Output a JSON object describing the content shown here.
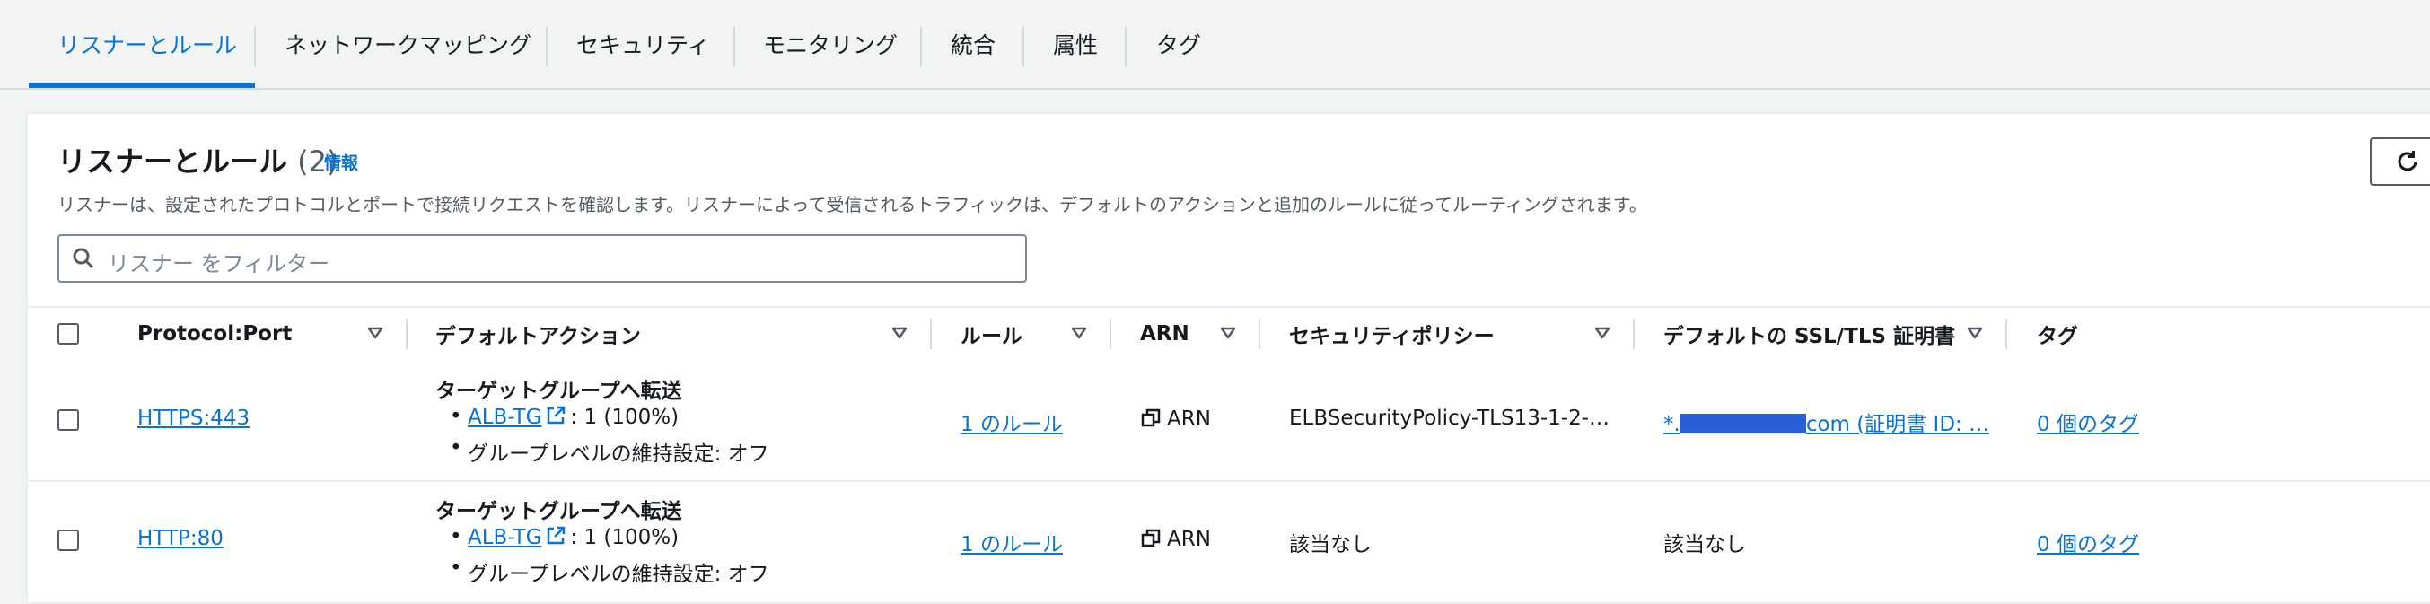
{
  "tabs": [
    {
      "label": "リスナーとルール"
    },
    {
      "label": "ネットワークマッピング"
    },
    {
      "label": "セキュリティ"
    },
    {
      "label": "モニタリング"
    },
    {
      "label": "統合"
    },
    {
      "label": "属性"
    },
    {
      "label": "タグ"
    }
  ],
  "panel": {
    "title": "リスナーとルール",
    "count": "(2)",
    "info": "情報",
    "description": "リスナーは、設定されたプロトコルとポートで接続リクエストを確認します。リスナーによって受信されるトラフィックは、デフォルトのアクションと追加のルールに従ってルーティングされます。",
    "search_placeholder": "リスナー をフィルター"
  },
  "columns": [
    {
      "label": "Protocol:Port"
    },
    {
      "label": "デフォルトアクション"
    },
    {
      "label": "ルール"
    },
    {
      "label": "ARN"
    },
    {
      "label": "セキュリティポリシー"
    },
    {
      "label": "デフォルトの SSL/TLS 証明書"
    },
    {
      "label": "タグ"
    }
  ],
  "rows": [
    {
      "protocol_port": "HTTPS:443",
      "action_title": "ターゲットグループへ転送",
      "target_group": "ALB-TG",
      "target_weight": ": 1 (100%)",
      "stickiness": "グループレベルの維持設定: オフ",
      "rules": "1 のルール",
      "arn": "ARN",
      "security_policy": "ELBSecurityPolicy-TLS13-1-2-…",
      "cert_prefix": "*.",
      "cert_suffix": "com (証明書 ID: …",
      "tags": "0 個のタグ"
    },
    {
      "protocol_port": "HTTP:80",
      "action_title": "ターゲットグループへ転送",
      "target_group": "ALB-TG",
      "target_weight": ": 1 (100%)",
      "stickiness": "グループレベルの維持設定: オフ",
      "rules": "1 のルール",
      "arn": "ARN",
      "security_policy": "該当なし",
      "certificate": "該当なし",
      "tags": "0 個のタグ"
    }
  ],
  "colors": {
    "accent": "#0972d3",
    "text": "#16191f",
    "muted": "#545b64",
    "background": "#f2f3f3",
    "redaction": "#2b5fd9"
  },
  "icons": [
    "refresh-icon",
    "search-icon",
    "sort-caret-icon",
    "external-link-icon",
    "copy-icon"
  ]
}
